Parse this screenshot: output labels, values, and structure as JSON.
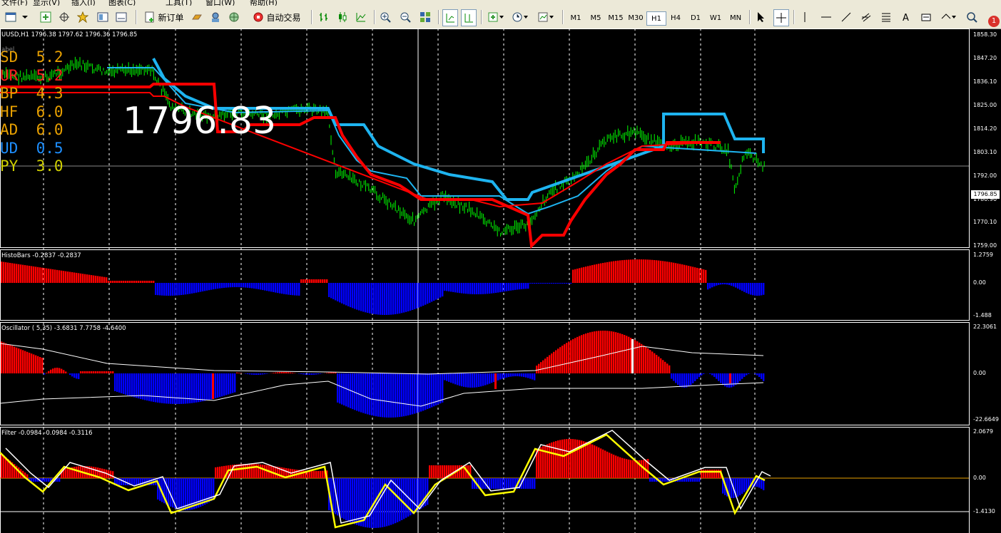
{
  "menu": [
    "文件(F)",
    "显示(V)",
    "插入(I)",
    "图表(C)",
    "工具(T)",
    "窗口(W)",
    "帮助(H)"
  ],
  "toolbar": {
    "new_order": "新订单",
    "auto_trading": "自动交易",
    "timeframes": [
      "M1",
      "M5",
      "M15",
      "M30",
      "H1",
      "H4",
      "D1",
      "W1",
      "MN"
    ],
    "active_timeframe": "H1",
    "notification_count": "1"
  },
  "main_chart": {
    "header": "UUSD,H1  1796.38 1797.62 1796.36 1796.85",
    "label": "abel",
    "big_price": "1796.83",
    "current_price": "1796.85",
    "axis": [
      "1858.30",
      "1847.20",
      "1836.10",
      "1825.00",
      "1814.20",
      "1803.10",
      "1792.00",
      "1780.90",
      "1770.10",
      "1759.00"
    ],
    "stats": [
      {
        "name": "SD",
        "value": "5.2",
        "color": "#E8A000"
      },
      {
        "name": "UR",
        "value": "5.2",
        "color": "#FF2020"
      },
      {
        "name": "BP",
        "value": "4.3",
        "color": "#E8A000"
      },
      {
        "name": "HF",
        "value": "6.0",
        "color": "#E8A000"
      },
      {
        "name": "AD",
        "value": "6.0",
        "color": "#E8A000"
      },
      {
        "name": "UD",
        "value": "0.5",
        "color": "#1E8FFF"
      },
      {
        "name": "PY",
        "value": "3.0",
        "color": "#D0D000"
      }
    ]
  },
  "histo": {
    "header": "HistoBars -0.2837 -0.2837",
    "axis": [
      "1.2759",
      "0.00",
      "-1.488"
    ]
  },
  "oscillator": {
    "header": "Oscillator ( 5,35) -3.6831 7.7758 -4.6400",
    "axis": [
      "22.3061",
      "0.00",
      "-22.6649"
    ]
  },
  "filter": {
    "header": "Filter -0.0984 -0.0984 -0.3116",
    "axis": [
      "2.0679",
      "0.00",
      "-1.4130"
    ]
  },
  "colors": {
    "up": "#FF0000",
    "down": "#0000FF",
    "candle": "#00FF00",
    "band_upper": "#1EB4F0",
    "band_lower": "#FF0000",
    "signal": "#FFFFFF",
    "filter_yellow": "#FFFF00"
  }
}
